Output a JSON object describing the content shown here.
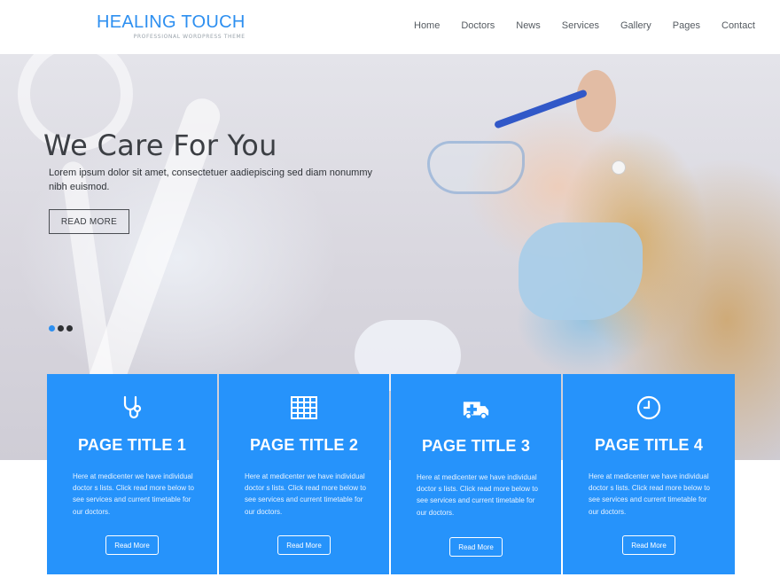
{
  "brand": {
    "title": "HEALING TOUCH",
    "subtitle": "PROFESSIONAL WORDPRESS THEME",
    "accent_color": "#2d8ff0"
  },
  "nav": {
    "items": [
      {
        "label": "Home"
      },
      {
        "label": "Doctors"
      },
      {
        "label": "News"
      },
      {
        "label": "Services"
      },
      {
        "label": "Gallery"
      },
      {
        "label": "Pages"
      },
      {
        "label": "Contact"
      }
    ]
  },
  "hero": {
    "title": "We Care For You",
    "text": "Lorem ipsum dolor sit amet, consectetuer aadiepiscing sed diam nonummy nibh euismod.",
    "button_label": "READ MORE",
    "slides": 3,
    "active_slide": 1
  },
  "cards": [
    {
      "icon": "stethoscope-icon",
      "title": "PAGE TITLE 1",
      "text": "Here at medicenter we have individual doctor s lists. Click read more below to see services and current timetable for our doctors.",
      "button_label": "Read More"
    },
    {
      "icon": "calendar-grid-icon",
      "title": "PAGE TITLE 2",
      "text": "Here at medicenter we have individual doctor s lists. Click read more below to see services and current timetable for our doctors.",
      "button_label": "Read More"
    },
    {
      "icon": "ambulance-icon",
      "title": "PAGE TITLE 3",
      "text": "Here at medicenter we have individual doctor s lists. Click read more below to see services and current timetable for our doctors.",
      "button_label": "Read More"
    },
    {
      "icon": "clock-icon",
      "title": "PAGE TITLE 4",
      "text": "Here at medicenter we have individual doctor s lists. Click read more below to see services and current timetable for our doctors.",
      "button_label": "Read More"
    }
  ],
  "colors": {
    "card_background": "#2693fb",
    "text_dark": "#3c3f44"
  }
}
